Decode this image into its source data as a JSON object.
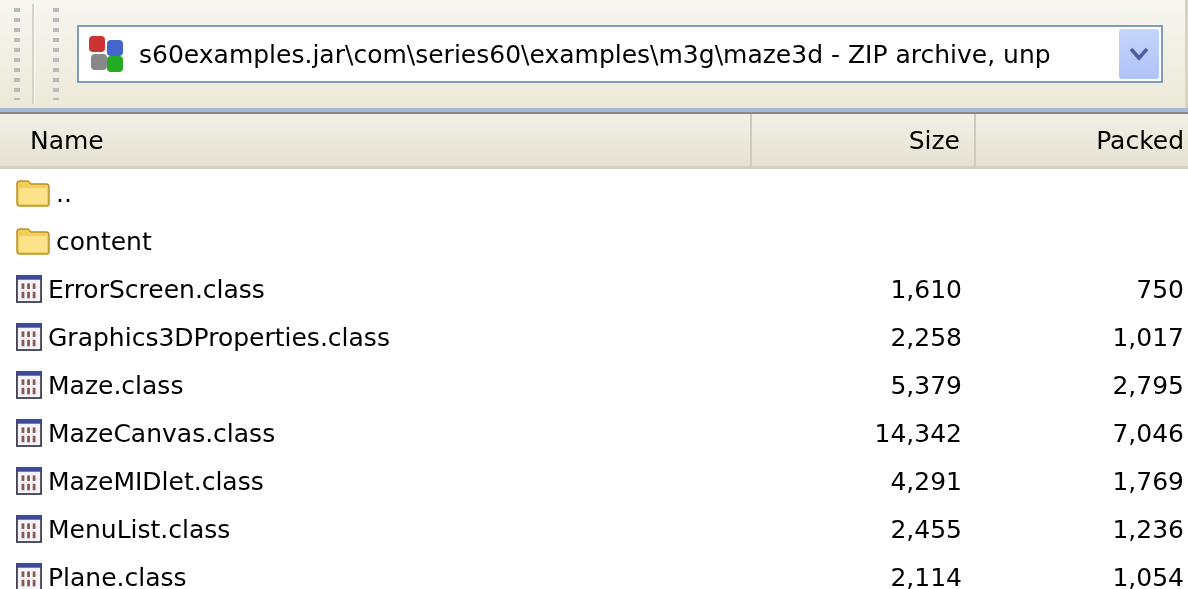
{
  "address": {
    "value": "s60examples.jar\\com\\series60\\examples\\m3g\\maze3d - ZIP archive, unp"
  },
  "table": {
    "columns": [
      "Name",
      "Size",
      "Packed"
    ],
    "rows": [
      {
        "kind": "folder",
        "name": ".."
      },
      {
        "kind": "folder",
        "name": "content"
      },
      {
        "kind": "file",
        "name": "ErrorScreen.class",
        "size": "1,610",
        "packed": "750"
      },
      {
        "kind": "file",
        "name": "Graphics3DProperties.class",
        "size": "2,258",
        "packed": "1,017"
      },
      {
        "kind": "file",
        "name": "Maze.class",
        "size": "5,379",
        "packed": "2,795"
      },
      {
        "kind": "file",
        "name": "MazeCanvas.class",
        "size": "14,342",
        "packed": "7,046"
      },
      {
        "kind": "file",
        "name": "MazeMIDlet.class",
        "size": "4,291",
        "packed": "1,769"
      },
      {
        "kind": "file",
        "name": "MenuList.class",
        "size": "2,455",
        "packed": "1,236"
      },
      {
        "kind": "file",
        "name": "Plane.class",
        "size": "2,114",
        "packed": "1,054"
      }
    ]
  }
}
